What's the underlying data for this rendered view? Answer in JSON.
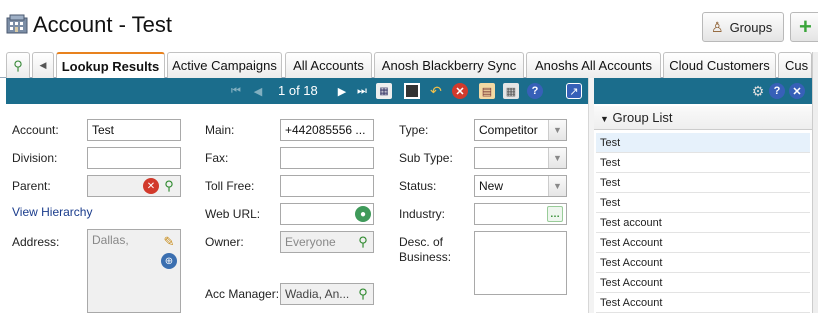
{
  "header": {
    "title": "Account - Test",
    "groups_label": "Groups"
  },
  "tabs": [
    {
      "label": "Lookup Results"
    },
    {
      "label": "Active Campaigns"
    },
    {
      "label": "All Accounts"
    },
    {
      "label": "Anosh Blackberry Sync"
    },
    {
      "label": "Anoshs All Accounts"
    },
    {
      "label": "Cloud Customers"
    },
    {
      "label": "Cus"
    }
  ],
  "toolbar": {
    "pager": "1 of 18"
  },
  "form": {
    "account_label": "Account:",
    "account_value": "Test",
    "division_label": "Division:",
    "division_value": "",
    "parent_label": "Parent:",
    "parent_value": "",
    "view_hierarchy": "View Hierarchy",
    "address_label": "Address:",
    "address_value": "Dallas,",
    "main_label": "Main:",
    "main_value": "+442085556 ...",
    "fax_label": "Fax:",
    "fax_value": "",
    "toll_free_label": "Toll Free:",
    "toll_free_value": "",
    "web_url_label": "Web URL:",
    "web_url_value": "",
    "owner_label": "Owner:",
    "owner_value": "Everyone",
    "acc_manager_label": "Acc Manager:",
    "acc_manager_value": "Wadia, An...",
    "type_label": "Type:",
    "type_value": "Competitor",
    "sub_type_label": "Sub Type:",
    "sub_type_value": "",
    "status_label": "Status:",
    "status_value": "New",
    "industry_label": "Industry:",
    "industry_value": "",
    "desc_label_1": "Desc. of",
    "desc_label_2": "Business:",
    "desc_value": ""
  },
  "group_list": {
    "title": "Group List",
    "items": [
      "Test",
      "Test",
      "Test",
      "Test",
      "Test account",
      "Test Account",
      "Test Account",
      "Test Account",
      "Test Account"
    ]
  },
  "colors": {
    "toolbar": "#1b6d8c",
    "active_tab_accent": "#e8821e",
    "link": "#1a3c8c"
  }
}
